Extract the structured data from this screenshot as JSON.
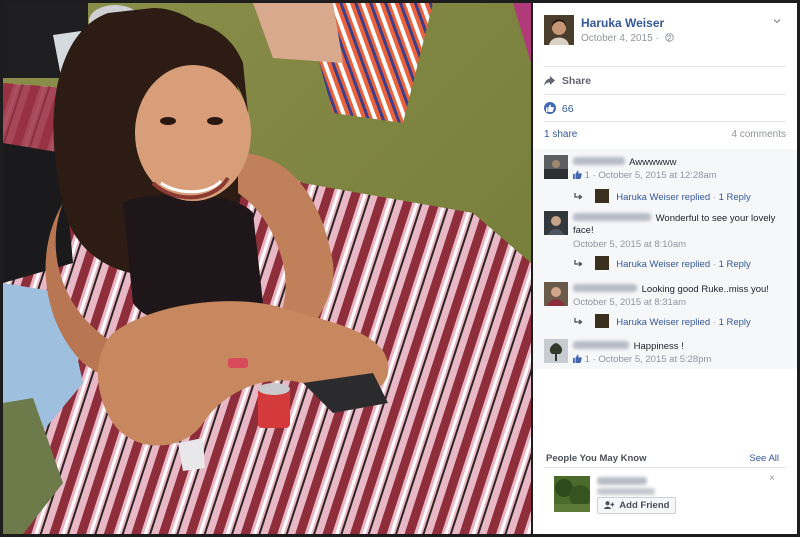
{
  "post": {
    "author_name": "Haruka Weiser",
    "date": "October 4, 2015",
    "date_separator": "·",
    "share_label": "Share",
    "like_count": "66",
    "shares": "1 share",
    "comment_count": "4 comments"
  },
  "comments": [
    {
      "text": "Awwwwww",
      "like_count": "1",
      "time": "October 5, 2015 at 12:28am",
      "reply": {
        "author": "Haruka Weiser",
        "verb": "replied",
        "count": "1 Reply"
      }
    },
    {
      "text": "Wonderful to see your lovely face!",
      "like_count": "",
      "time": "October 5, 2015 at 8:10am",
      "reply": {
        "author": "Haruka Weiser",
        "verb": "replied",
        "count": "1 Reply"
      }
    },
    {
      "text": "Looking good Ruke..miss you!",
      "like_count": "",
      "time": "October 5, 2015 at 8:31am",
      "reply": {
        "author": "Haruka Weiser",
        "verb": "replied",
        "count": "1 Reply"
      }
    },
    {
      "text": "Happiness !",
      "like_count": "1",
      "time": "October 5, 2015 at 5:28pm",
      "reply": null
    }
  ],
  "people_you_may_know": {
    "title": "People You May Know",
    "see_all": "See All",
    "close": "×",
    "add_friend_label": "Add Friend"
  },
  "separator": "·",
  "icons": [
    "chevron-down-icon",
    "globe-icon",
    "share-icon",
    "like-icon",
    "reply-arrow-icon",
    "add-friend-icon",
    "close-icon"
  ],
  "colors": {
    "link": "#365899",
    "like_blue": "#4267b2",
    "muted": "#90949c",
    "panel_bg": "#ffffff",
    "comments_bg": "#f6f7f9"
  }
}
